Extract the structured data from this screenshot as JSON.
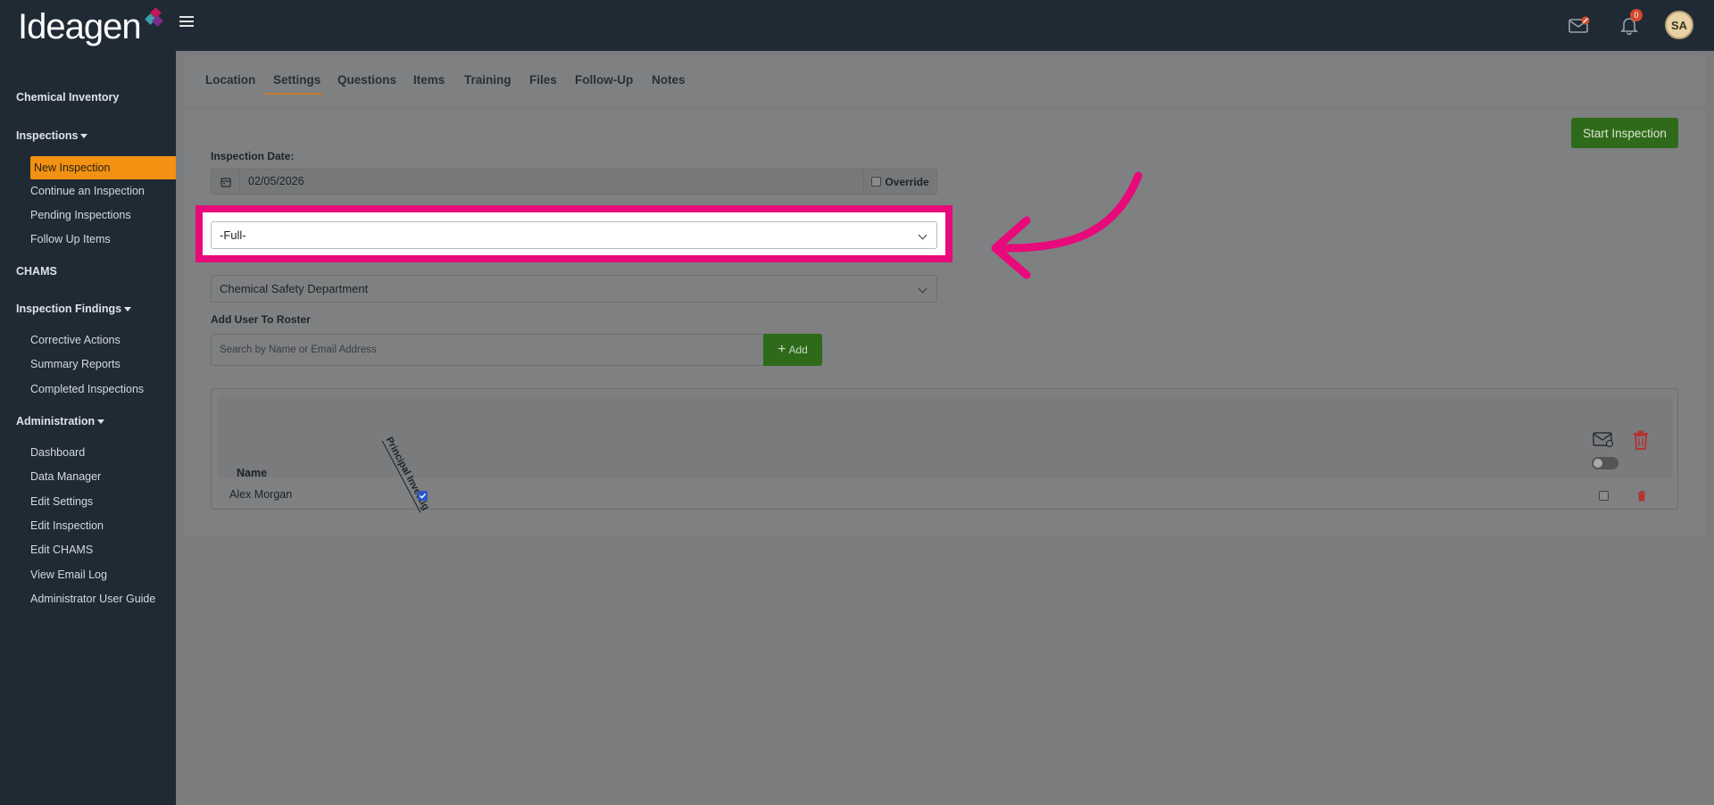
{
  "header": {
    "logo_text": "Ideagen",
    "notification_count": "0",
    "avatar_initials": "SA"
  },
  "sidebar": {
    "chemical_inventory": "Chemical Inventory",
    "inspections": "Inspections",
    "new_inspection": "New Inspection",
    "continue_inspection": "Continue an Inspection",
    "pending_inspections": "Pending Inspections",
    "follow_up_items": "Follow Up Items",
    "chams": "CHAMS",
    "inspection_findings": "Inspection Findings",
    "corrective_actions": "Corrective Actions",
    "summary_reports": "Summary Reports",
    "completed_inspections": "Completed Inspections",
    "administration": "Administration",
    "dashboard": "Dashboard",
    "data_manager": "Data Manager",
    "edit_settings": "Edit Settings",
    "edit_inspection": "Edit Inspection",
    "edit_chams": "Edit CHAMS",
    "view_email_log": "View Email Log",
    "admin_user_guide": "Administrator User Guide"
  },
  "tabs": {
    "location": "Location",
    "settings": "Settings",
    "questions": "Questions",
    "items": "Items",
    "training": "Training",
    "files": "Files",
    "follow_up": "Follow-Up",
    "notes": "Notes"
  },
  "form": {
    "start_button": "Start Inspection",
    "date_label": "Inspection Date:",
    "date_value": "02/05/2026",
    "override_label": "Override",
    "type_value": "-Full-",
    "department_value": "Chemical Safety Department",
    "roster_label": "Add User To Roster",
    "search_placeholder": "Search by Name or Email Address",
    "add_button": "Add"
  },
  "roster": {
    "col_name": "Name",
    "col_principal": "Principal Investig",
    "rows": [
      {
        "name": "Alex Morgan",
        "principal": true,
        "email": false
      }
    ]
  },
  "colors": {
    "sidebar_bg": "#1f2a35",
    "active_item": "#f29112",
    "highlight": "#e8097a",
    "primary_green": "#2f6a1a"
  }
}
